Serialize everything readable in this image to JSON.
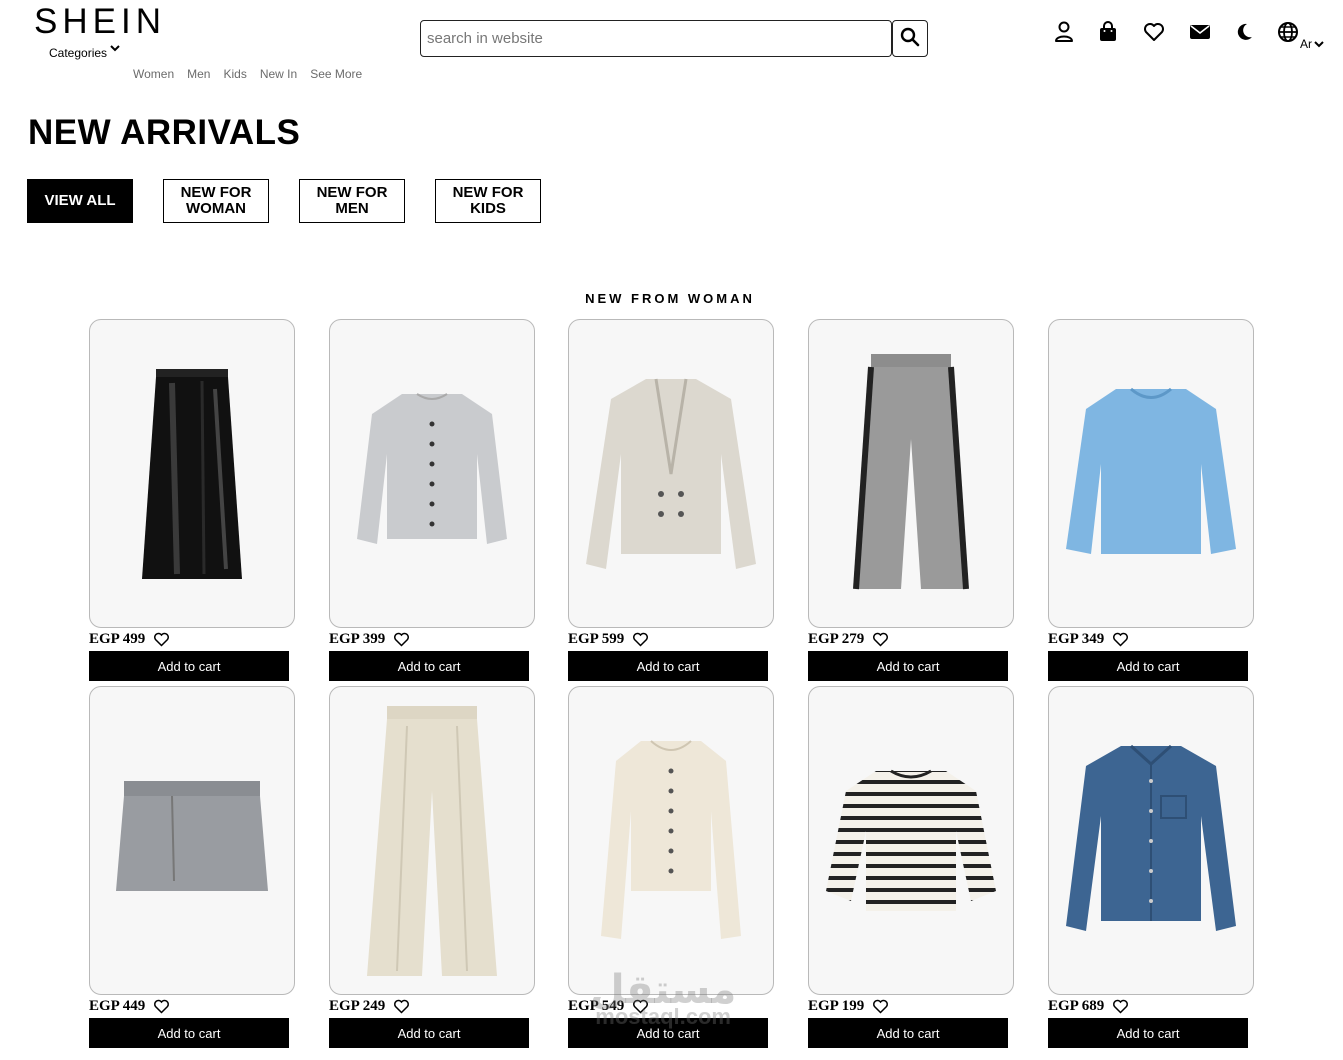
{
  "header": {
    "logo": "SHEIN",
    "categories_label": "Categories",
    "nav": [
      "Women",
      "Men",
      "Kids",
      "New In",
      "See More"
    ],
    "search_placeholder": "search in website",
    "language": "Ar",
    "icons": [
      "user-icon",
      "shopping-bag-icon",
      "heart-icon",
      "envelope-icon",
      "moon-icon",
      "globe-icon"
    ]
  },
  "page": {
    "title": "NEW ARRIVALS",
    "filters": [
      {
        "label": "VIEW ALL",
        "active": true
      },
      {
        "label": "NEW FOR WOMAN",
        "active": false
      },
      {
        "label": "NEW FOR MEN",
        "active": false
      },
      {
        "label": "NEW FOR KIDS",
        "active": false
      }
    ],
    "section_title": "NEW FROM WOMAN"
  },
  "products": [
    {
      "price": "EGP 499",
      "item": "black-leather-skirt"
    },
    {
      "price": "EGP 399",
      "item": "grey-fluffy-cardigan"
    },
    {
      "price": "EGP 599",
      "item": "beige-double-breasted-blazer"
    },
    {
      "price": "EGP 279",
      "item": "grey-wide-leg-jeans"
    },
    {
      "price": "EGP 349",
      "item": "light-blue-sweater"
    },
    {
      "price": "EGP 449",
      "item": "grey-mini-skirt"
    },
    {
      "price": "EGP 249",
      "item": "cream-wide-trousers"
    },
    {
      "price": "EGP 549",
      "item": "cream-knit-cardigan"
    },
    {
      "price": "EGP 199",
      "item": "striped-long-sleeve-top"
    },
    {
      "price": "EGP 689",
      "item": "denim-shirt"
    }
  ],
  "add_to_cart_label": "Add to cart",
  "watermark": {
    "arabic": "مستقل",
    "latin": "mostaql.com"
  },
  "colors": {
    "accent": "#000000",
    "card_border": "#b9b9b9",
    "card_bg": "#f7f7f7",
    "nav_text": "#6b6b6b"
  }
}
